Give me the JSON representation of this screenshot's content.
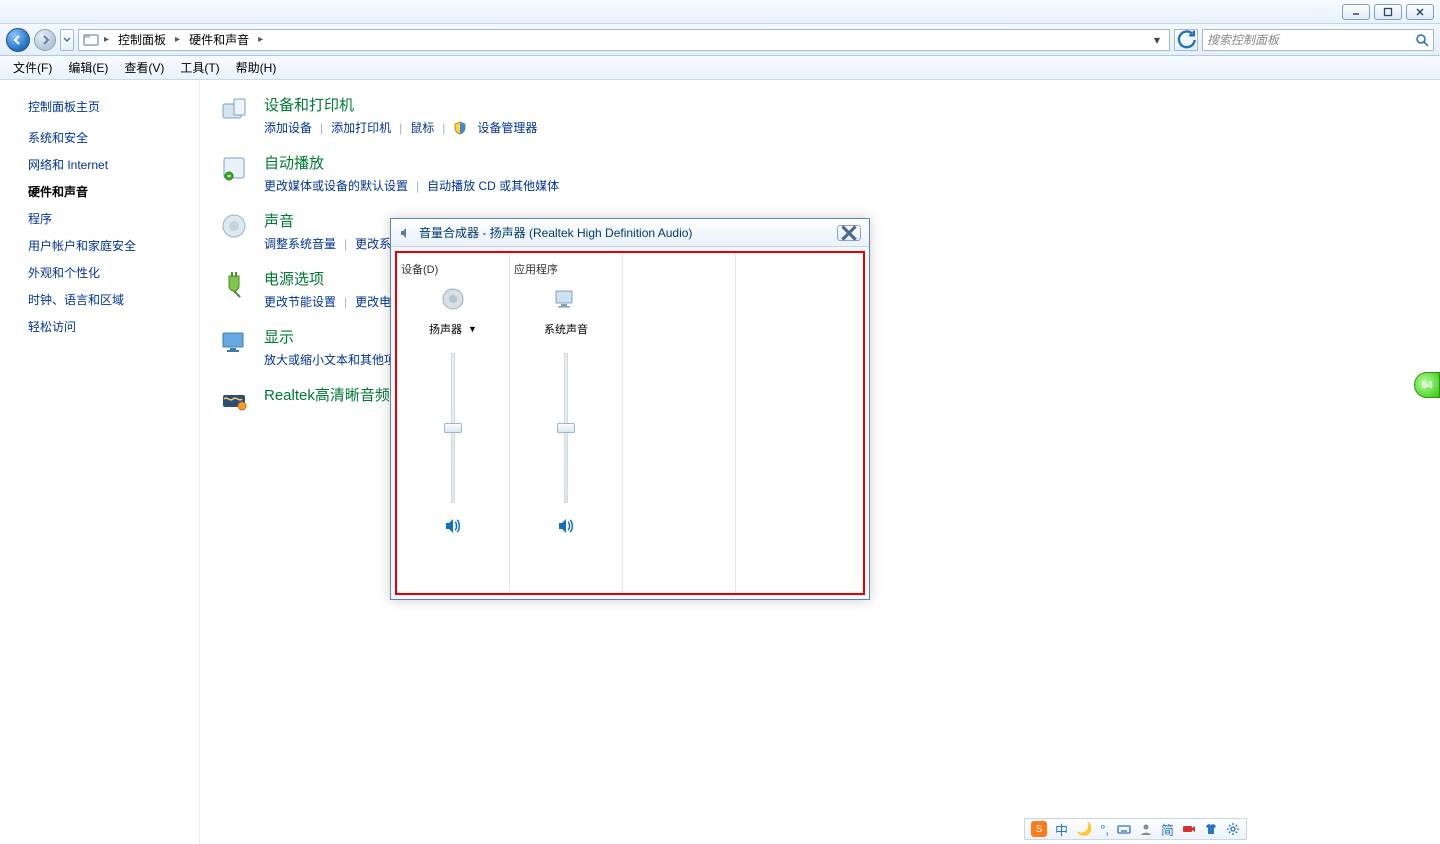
{
  "titlebar": {
    "minimize": "min",
    "maximize": "max",
    "close": "close"
  },
  "breadcrumb": {
    "root": "控制面板",
    "current": "硬件和声音"
  },
  "search": {
    "placeholder": "搜索控制面板"
  },
  "menu": {
    "file": "文件(F)",
    "edit": "编辑(E)",
    "view": "查看(V)",
    "tools": "工具(T)",
    "help": "帮助(H)"
  },
  "sidebar": {
    "header": "控制面板主页",
    "items": [
      {
        "label": "系统和安全"
      },
      {
        "label": "网络和 Internet"
      },
      {
        "label": "硬件和声音",
        "active": true
      },
      {
        "label": "程序"
      },
      {
        "label": "用户帐户和家庭安全"
      },
      {
        "label": "外观和个性化"
      },
      {
        "label": "时钟、语言和区域"
      },
      {
        "label": "轻松访问"
      }
    ]
  },
  "categories": [
    {
      "title": "设备和打印机",
      "links": [
        "添加设备",
        "添加打印机",
        "鼠标"
      ],
      "shield_link": "设备管理器"
    },
    {
      "title": "自动播放",
      "links": [
        "更改媒体或设备的默认设置",
        "自动播放 CD 或其他媒体"
      ]
    },
    {
      "title": "声音",
      "links": [
        "调整系统音量",
        "更改系"
      ]
    },
    {
      "title": "电源选项",
      "links": [
        "更改节能设置",
        "更改电"
      ]
    },
    {
      "title": "显示",
      "links": [
        "放大或缩小文本和其他项"
      ]
    },
    {
      "title": "Realtek高清晰音频",
      "links": []
    }
  ],
  "mixer": {
    "title": "音量合成器 - 扬声器 (Realtek High Definition Audio)",
    "device_header": "设备(D)",
    "app_header": "应用程序",
    "device_name": "扬声器",
    "app_name": "系统声音",
    "device_level": 50,
    "app_level": 50
  },
  "side_badge": "54",
  "tray": {
    "items": [
      "中",
      "简"
    ]
  }
}
